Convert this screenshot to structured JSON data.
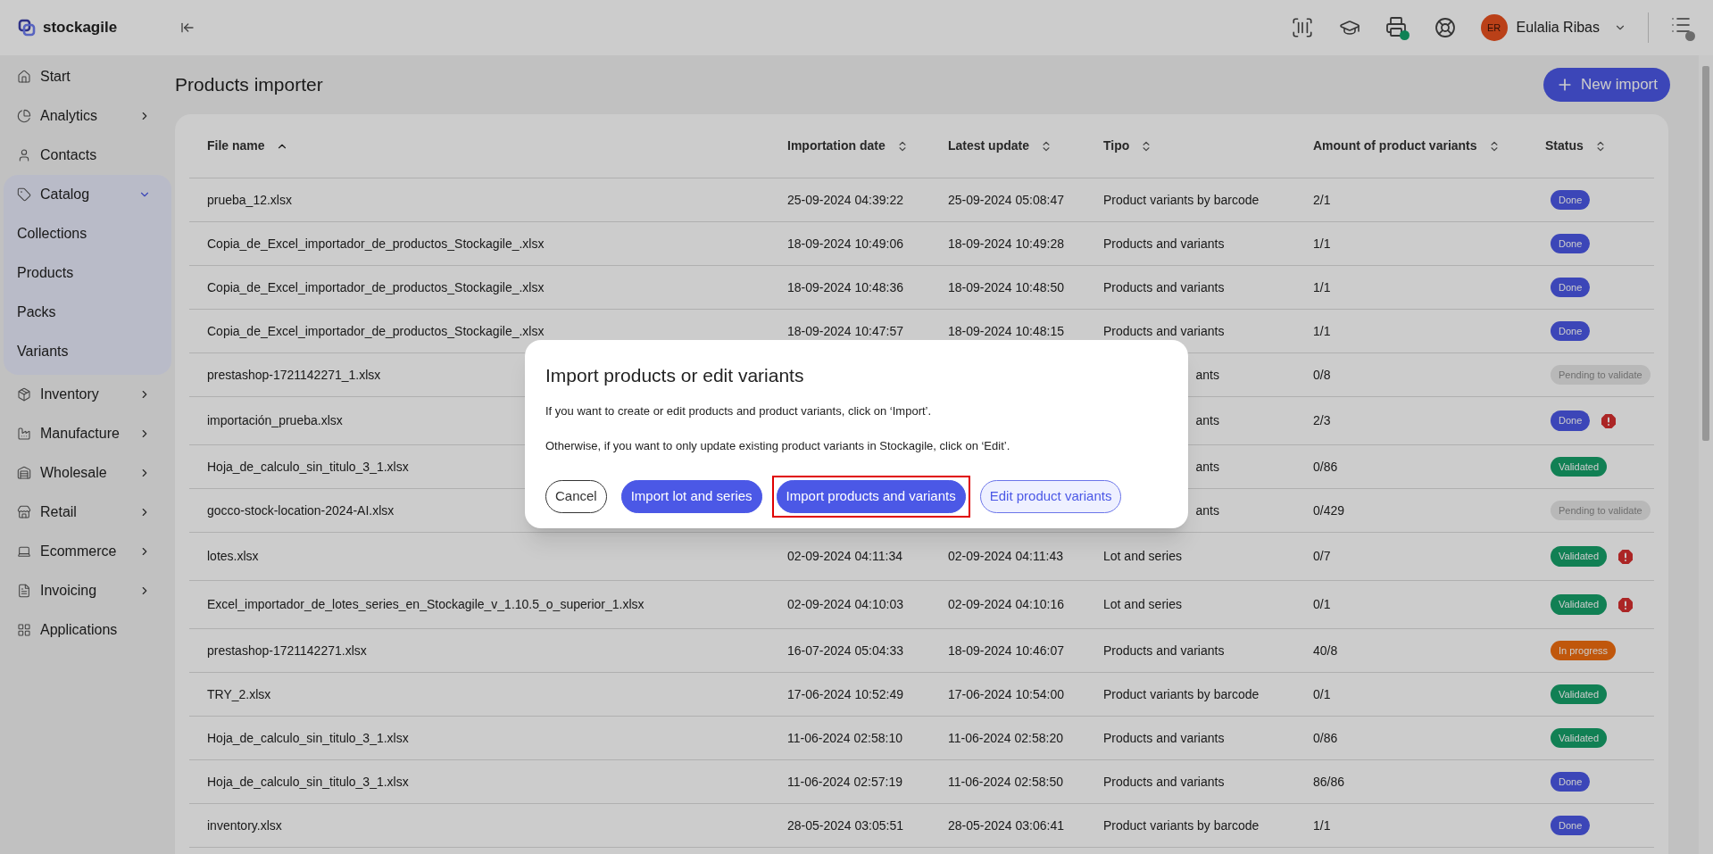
{
  "brand": "stockagile",
  "user": {
    "initials": "ER",
    "name": "Eulalia Ribas"
  },
  "sidebar": {
    "items": [
      {
        "label": "Start",
        "expandable": false
      },
      {
        "label": "Analytics",
        "expandable": true,
        "expanded": false
      },
      {
        "label": "Contacts",
        "expandable": false
      },
      {
        "label": "Catalog",
        "expandable": true,
        "expanded": true,
        "children": [
          {
            "label": "Collections"
          },
          {
            "label": "Products"
          },
          {
            "label": "Packs"
          },
          {
            "label": "Variants"
          }
        ]
      },
      {
        "label": "Inventory",
        "expandable": true,
        "expanded": false
      },
      {
        "label": "Manufacture",
        "expandable": true,
        "expanded": false
      },
      {
        "label": "Wholesale",
        "expandable": true,
        "expanded": false
      },
      {
        "label": "Retail",
        "expandable": true,
        "expanded": false
      },
      {
        "label": "Ecommerce",
        "expandable": true,
        "expanded": false
      },
      {
        "label": "Invoicing",
        "expandable": true,
        "expanded": false
      },
      {
        "label": "Applications",
        "expandable": false
      }
    ]
  },
  "page": {
    "title": "Products importer",
    "new_button": "New import"
  },
  "table": {
    "columns": [
      {
        "label": "File name",
        "sorted": true
      },
      {
        "label": "Importation date",
        "sorted": false
      },
      {
        "label": "Latest update",
        "sorted": false
      },
      {
        "label": "Tipo",
        "sorted": false
      },
      {
        "label": "Amount of product variants",
        "sorted": false
      },
      {
        "label": "Status",
        "sorted": false
      }
    ],
    "rows": [
      {
        "file": "prueba_12.xlsx",
        "imported": "25-09-2024 04:39:22",
        "updated": "25-09-2024 05:08:47",
        "tipo": "Product variants by barcode",
        "amount": "2/1",
        "status": {
          "label": "Done",
          "kind": "done"
        },
        "error": false
      },
      {
        "file": "Copia_de_Excel_importador_de_productos_Stockagile_.xlsx",
        "imported": "18-09-2024 10:49:06",
        "updated": "18-09-2024 10:49:28",
        "tipo": "Products and variants",
        "amount": "1/1",
        "status": {
          "label": "Done",
          "kind": "done"
        },
        "error": false
      },
      {
        "file": "Copia_de_Excel_importador_de_productos_Stockagile_.xlsx",
        "imported": "18-09-2024 10:48:36",
        "updated": "18-09-2024 10:48:50",
        "tipo": "Products and variants",
        "amount": "1/1",
        "status": {
          "label": "Done",
          "kind": "done"
        },
        "error": false
      },
      {
        "file": "Copia_de_Excel_importador_de_productos_Stockagile_.xlsx",
        "imported": "18-09-2024 10:47:57",
        "updated": "18-09-2024 10:48:15",
        "tipo": "Products and variants",
        "amount": "1/1",
        "status": {
          "label": "Done",
          "kind": "done"
        },
        "error": false
      },
      {
        "file": "prestashop-1721142271_1.xlsx",
        "tipo": "ants",
        "tipo_covered": true,
        "amount": "0/8",
        "status": {
          "label": "Pending to validate",
          "kind": "pending"
        },
        "error": false
      },
      {
        "file": "importación_prueba.xlsx",
        "tipo": "ants",
        "tipo_covered": true,
        "amount": "2/3",
        "status": {
          "label": "Done",
          "kind": "done"
        },
        "error": true
      },
      {
        "file": "Hoja_de_calculo_sin_titulo_3_1.xlsx",
        "tipo": "ants",
        "tipo_covered": true,
        "amount": "0/86",
        "status": {
          "label": "Validated",
          "kind": "validated"
        },
        "error": false
      },
      {
        "file": "gocco-stock-location-2024-AI.xlsx",
        "tipo": "ants",
        "tipo_covered": true,
        "amount": "0/429",
        "status": {
          "label": "Pending to validate",
          "kind": "pending"
        },
        "error": false
      },
      {
        "file": "lotes.xlsx",
        "imported": "02-09-2024 04:11:34",
        "updated": "02-09-2024 04:11:43",
        "tipo": "Lot and series",
        "amount": "0/7",
        "status": {
          "label": "Validated",
          "kind": "validated"
        },
        "error": true
      },
      {
        "file": "Excel_importador_de_lotes_series_en_Stockagile_v_1.10.5_o_superior_1.xlsx",
        "imported": "02-09-2024 04:10:03",
        "updated": "02-09-2024 04:10:16",
        "tipo": "Lot and series",
        "amount": "0/1",
        "status": {
          "label": "Validated",
          "kind": "validated"
        },
        "error": true
      },
      {
        "file": "prestashop-1721142271.xlsx",
        "imported": "16-07-2024 05:04:33",
        "updated": "18-09-2024 10:46:07",
        "tipo": "Products and variants",
        "amount": "40/8",
        "status": {
          "label": "In progress",
          "kind": "in_progress"
        },
        "error": false
      },
      {
        "file": "TRY_2.xlsx",
        "imported": "17-06-2024 10:52:49",
        "updated": "17-06-2024 10:54:00",
        "tipo": "Product variants by barcode",
        "amount": "0/1",
        "status": {
          "label": "Validated",
          "kind": "validated"
        },
        "error": false
      },
      {
        "file": "Hoja_de_calculo_sin_titulo_3_1.xlsx",
        "imported": "11-06-2024 02:58:10",
        "updated": "11-06-2024 02:58:20",
        "tipo": "Products and variants",
        "amount": "0/86",
        "status": {
          "label": "Validated",
          "kind": "validated"
        },
        "error": false
      },
      {
        "file": "Hoja_de_calculo_sin_titulo_3_1.xlsx",
        "imported": "11-06-2024 02:57:19",
        "updated": "11-06-2024 02:58:50",
        "tipo": "Products and variants",
        "amount": "86/86",
        "status": {
          "label": "Done",
          "kind": "done"
        },
        "error": false
      },
      {
        "file": "inventory.xlsx",
        "imported": "28-05-2024 03:05:51",
        "updated": "28-05-2024 03:06:41",
        "tipo": "Product variants by barcode",
        "amount": "1/1",
        "status": {
          "label": "Done",
          "kind": "done"
        },
        "error": false
      }
    ]
  },
  "dialog": {
    "title": "Import products or edit variants",
    "paragraphs": [
      "If you want to create or edit products and product variants, click on ‘Import’.",
      "Otherwise, if you want to only update existing product variants in Stockagile, click on ‘Edit’."
    ],
    "buttons": [
      {
        "label": "Cancel",
        "kind": "outline",
        "highlighted": false
      },
      {
        "label": "Import lot and series",
        "kind": "primary",
        "highlighted": false
      },
      {
        "label": "Import products and variants",
        "kind": "primary",
        "highlighted": true
      },
      {
        "label": "Edit product variants",
        "kind": "soft",
        "highlighted": false
      }
    ]
  }
}
